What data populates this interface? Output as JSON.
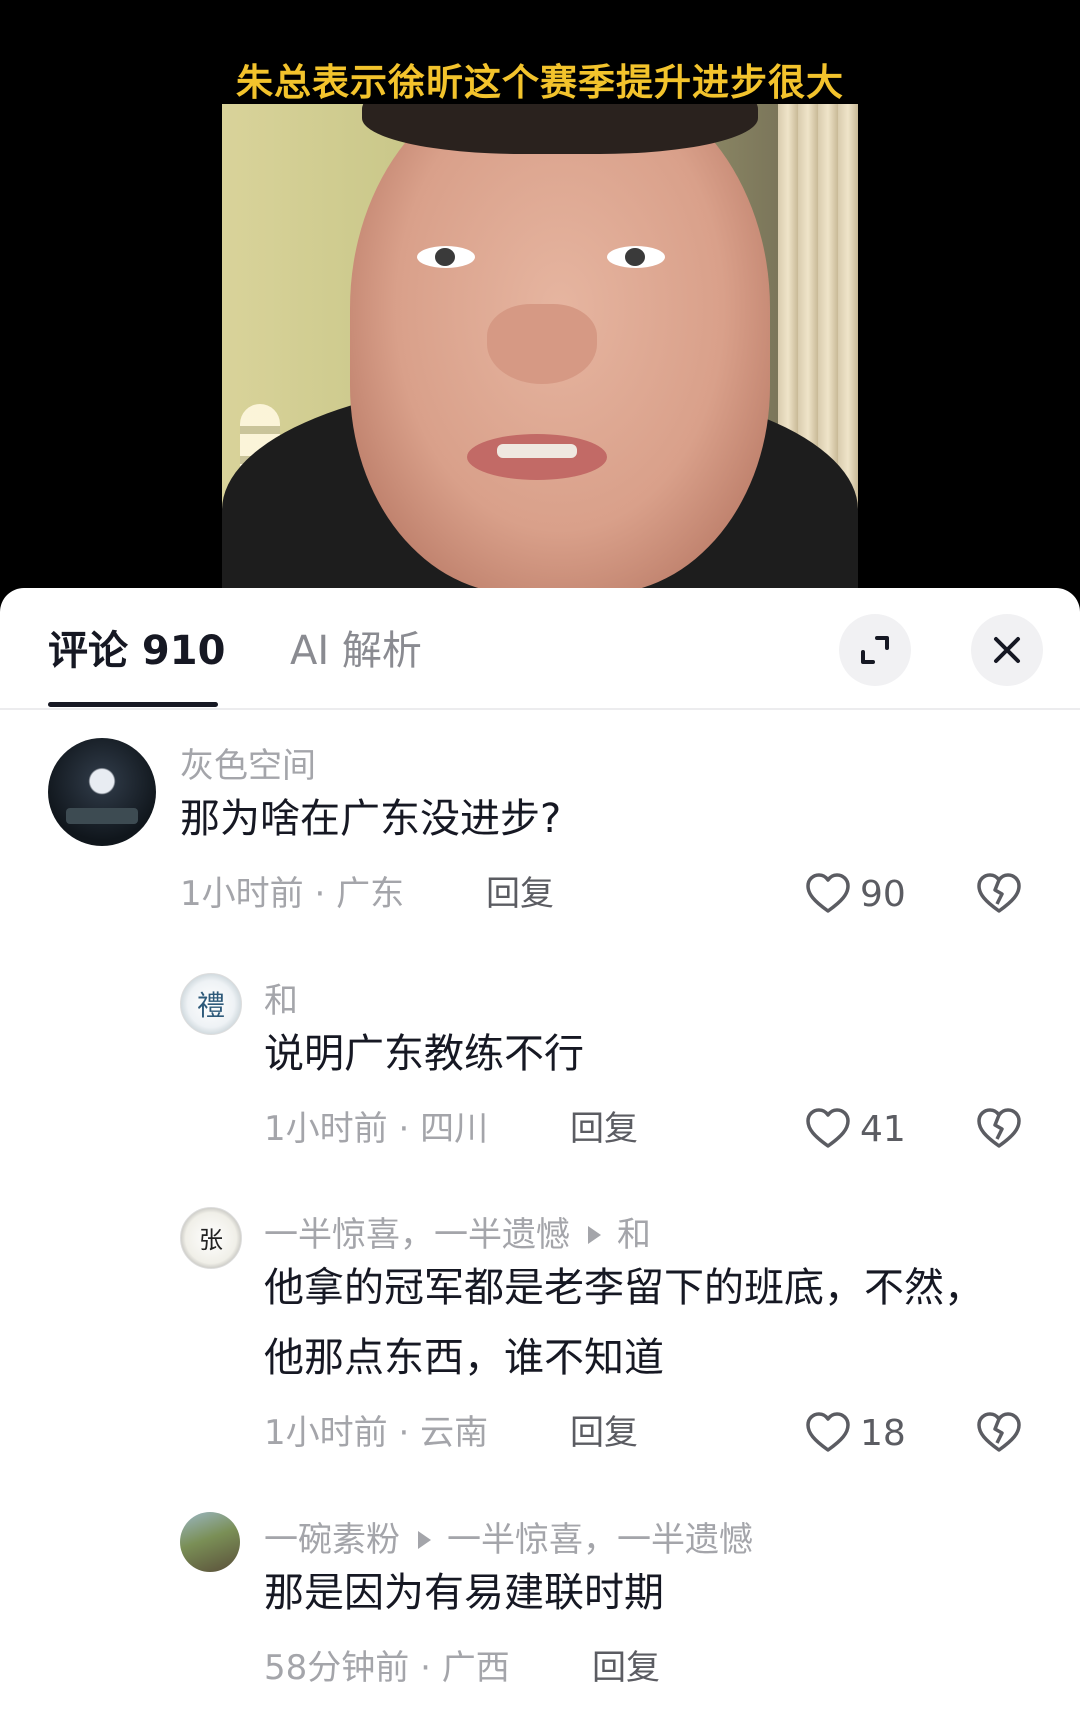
{
  "video": {
    "caption": "朱总表示徐昕这个赛季提升进步很大"
  },
  "tabs": {
    "comments_label": "评论 910",
    "ai_label": "AI 解析"
  },
  "comments": [
    {
      "username": "灰色空间",
      "text": "那为啥在广东没进步?",
      "time": "1小时前",
      "location": "广东",
      "reply_label": "回复",
      "likes": "90"
    },
    {
      "username": "和",
      "avatar_char": "禮",
      "text": "说明广东教练不行",
      "time": "1小时前",
      "location": "四川",
      "reply_label": "回复",
      "likes": "41"
    },
    {
      "username": "一半惊喜，一半遗憾",
      "reply_to": "和",
      "avatar_char": "张",
      "text_line1": "他拿的冠军都是老李留下的班底，不然，",
      "text_line2": "他那点东西，谁不知道",
      "time": "1小时前",
      "location": "云南",
      "reply_label": "回复",
      "likes": "18"
    },
    {
      "username": "一碗素粉",
      "reply_to": "一半惊喜，一半遗憾",
      "text": "那是因为有易建联时期",
      "time": "58分钟前",
      "location": "广西",
      "reply_label": "回复"
    }
  ],
  "colors": {
    "caption": "#f3c32c",
    "primary_text": "#161823",
    "secondary_text": "#a4a5aa"
  }
}
